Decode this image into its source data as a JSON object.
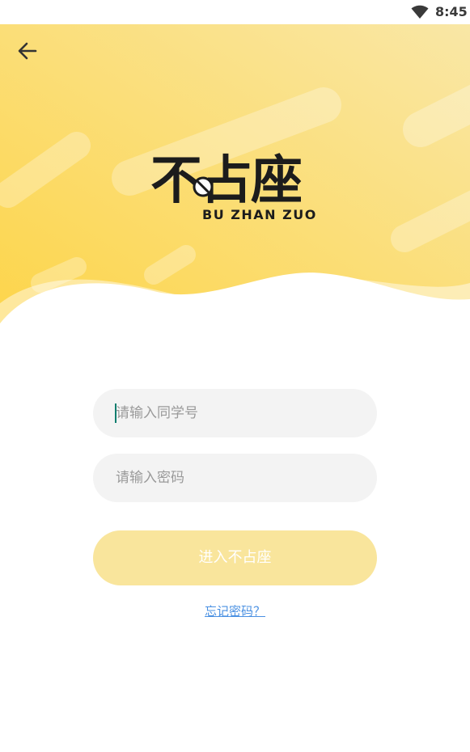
{
  "status_bar": {
    "time": "8:45",
    "wifi_icon": "wifi-icon"
  },
  "header": {
    "back_icon": "arrow-left-icon",
    "background_colors": [
      "#fdd54a",
      "#f9e49b"
    ]
  },
  "logo": {
    "glyphs": "不占座",
    "subtitle": "BU ZHAN ZUO"
  },
  "form": {
    "username_placeholder": "请输入同学号",
    "password_placeholder": "请输入密码",
    "submit_label": "进入不占座",
    "forgot_label": "忘记密码？"
  },
  "colors": {
    "accent": "#fbd84e",
    "button_disabled": "#f9e59c",
    "link": "#4a90e2",
    "field_bg": "#f3f3f3"
  }
}
